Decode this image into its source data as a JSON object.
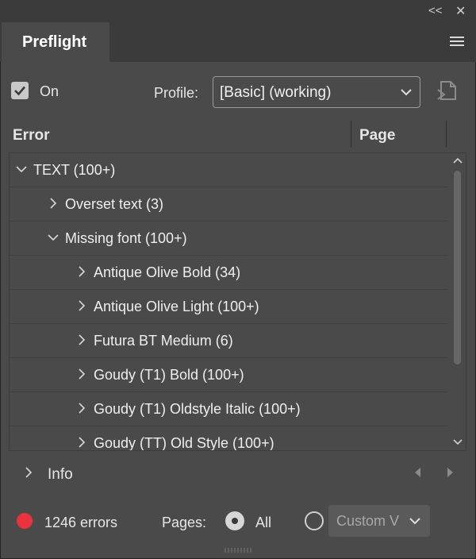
{
  "panel": {
    "tab_title": "Preflight",
    "collapse_glyph": "<<",
    "close_glyph": "✕"
  },
  "toolbar": {
    "on_label": "On",
    "on_checked": true,
    "profile_label": "Profile:",
    "profile_value": "[Basic] (working)"
  },
  "columns": {
    "error": "Error",
    "page": "Page"
  },
  "tree": [
    {
      "label": "TEXT (100+)",
      "level": 0,
      "expanded": true
    },
    {
      "label": "Overset text (3)",
      "level": 1,
      "expanded": false
    },
    {
      "label": "Missing font (100+)",
      "level": 1,
      "expanded": true
    },
    {
      "label": "Antique Olive Bold (34)",
      "level": 2,
      "expanded": false
    },
    {
      "label": "Antique Olive Light (100+)",
      "level": 2,
      "expanded": false
    },
    {
      "label": "Futura BT Medium (6)",
      "level": 2,
      "expanded": false
    },
    {
      "label": "Goudy (T1) Bold (100+)",
      "level": 2,
      "expanded": false
    },
    {
      "label": "Goudy (T1) Oldstyle Italic (100+)",
      "level": 2,
      "expanded": false
    },
    {
      "label": "Goudy (TT) Old Style (100+)",
      "level": 2,
      "expanded": false
    }
  ],
  "info": {
    "label": "Info"
  },
  "status": {
    "error_count": "1246 errors",
    "dot_color": "#e8323c",
    "pages_label": "Pages:",
    "all_label": "All",
    "custom_value": "Custom V"
  }
}
